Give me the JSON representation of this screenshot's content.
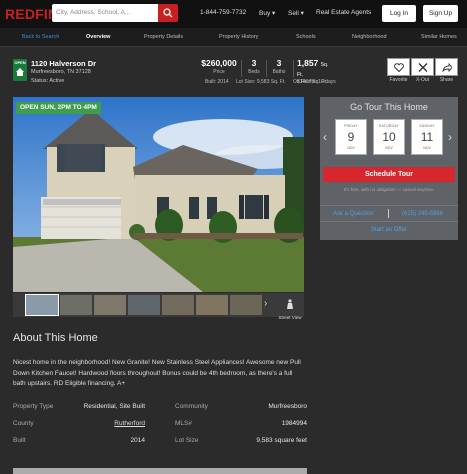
{
  "header": {
    "logo": "REDFIN",
    "search_placeholder": "City, Address, School, A...",
    "phone": "1-844-759-7732",
    "nav": [
      "Buy ▾",
      "Sell ▾",
      "Real Estate Agents"
    ],
    "login": "Log In",
    "signup": "Sign Up"
  },
  "subnav": {
    "back": "Back to Search",
    "tabs": [
      "Overview",
      "Property Details",
      "Property History",
      "Schools",
      "Neighborhood",
      "Similar Homes"
    ]
  },
  "listing": {
    "status_badge": "OPEN",
    "address": "1120 Halverson Dr",
    "city": "Murfreesboro, TN 37128",
    "status": "Status: Active",
    "price": "$260,000",
    "price_label": "Price",
    "beds": "3",
    "beds_label": "Beds",
    "baths": "3",
    "baths_label": "Baths",
    "sqft": "1,857",
    "sqft_unit": "Sq. Ft.",
    "per_sqft": "$140 / Sq. Ft.",
    "built": "Built: 2014",
    "lot": "Lot Size: 9,583 Sq. Ft.",
    "on_redfin": "On Redfin: 10 days",
    "actions": [
      "Favorite",
      "X-Out",
      "Share"
    ]
  },
  "photo": {
    "open_house": "OPEN SUN, 2PM TO 4PM",
    "street_view": "Street View"
  },
  "tour": {
    "title": "Go Tour This Home",
    "days": [
      {
        "dow": "FRIDAY",
        "num": "9",
        "mon": "NOV"
      },
      {
        "dow": "SATURDAY",
        "num": "10",
        "mon": "NOV"
      },
      {
        "dow": "SUNDAY",
        "num": "11",
        "mon": "NOV"
      }
    ],
    "schedule": "Schedule Tour",
    "free_note": "It's free, with no obligation — cancel anytime.",
    "ask": "Ask a Question",
    "phone": "(615) 240-5866",
    "offer": "Start an Offer"
  },
  "about": {
    "heading": "About This Home",
    "text": "Nicest home in the neighborhood! New Granite! New Stainless Steel Appliances! Awesome new Pull Down Kitchen Faucet! Hardwood floors throughout! Bonus could be 4th bedroom, as there's a full bath upstairs. RD Eligible financing. A+"
  },
  "facts": [
    {
      "k1": "Property Type",
      "v1": "Residential, Site Built",
      "k2": "Community",
      "v2": "Murfreesboro"
    },
    {
      "k1": "County",
      "v1": "Rutherford",
      "k2": "MLS#",
      "v2": "1984994"
    },
    {
      "k1": "Built",
      "v1": "2014",
      "k2": "Lot Size",
      "v2": "9,583 square feet"
    }
  ],
  "colors": {
    "brand": "#c82021",
    "link": "#4fa0e6",
    "badge": "#3e9d4f"
  }
}
